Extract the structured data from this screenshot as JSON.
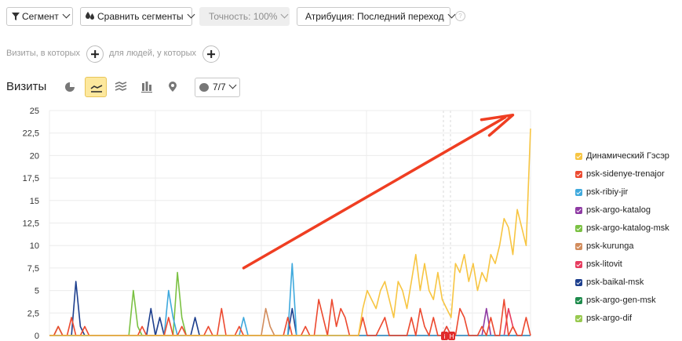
{
  "toolbar": {
    "segment_label": "Сегмент",
    "compare_label": "Сравнить сегменты",
    "accuracy_label": "Точность: 100%",
    "attribution_label": "Атрибуция: Последний переход",
    "help_glyph": "?"
  },
  "filters": {
    "visits_text": "Визиты, в которых",
    "people_text": "для людей, у которых"
  },
  "report": {
    "title": "Визиты",
    "comments_label": "7/7",
    "active_view": "line-chart"
  },
  "colors": {
    "accent": "#fde89d",
    "arrow": "#ef3e22"
  },
  "chart_data": {
    "type": "line",
    "ylim": [
      0,
      25
    ],
    "y_ticks": [
      "0",
      "2,5",
      "5",
      "7,5",
      "10",
      "12,5",
      "15",
      "17,5",
      "20",
      "22,5",
      "25"
    ],
    "x_points": 110,
    "series": [
      {
        "name": "Динамический Гэсэр",
        "color": "#f7c542",
        "values": [
          0,
          0,
          0,
          0,
          0,
          0,
          0,
          0,
          0,
          0,
          0,
          0,
          0,
          0,
          0,
          0,
          0,
          0,
          0,
          0,
          0,
          0,
          0,
          0,
          0,
          0,
          0,
          0,
          0,
          0,
          0,
          0,
          0,
          0,
          0,
          0,
          0,
          0,
          0,
          0,
          0,
          0,
          0,
          0,
          0,
          0,
          0,
          0,
          0,
          0,
          0,
          0,
          0,
          0,
          0,
          0,
          0,
          0,
          0,
          0,
          0,
          0,
          0,
          0,
          0,
          0,
          0,
          0,
          0,
          0,
          0,
          3,
          5,
          4,
          3,
          5,
          6,
          4,
          2,
          6,
          5,
          3,
          6,
          9,
          5,
          8,
          5,
          4,
          7,
          4,
          3,
          2,
          8,
          7,
          9,
          6,
          8,
          5,
          7,
          6,
          9,
          8,
          10,
          13,
          12,
          9,
          14,
          12,
          10,
          23
        ]
      },
      {
        "name": "psk-sidenye-trenajor",
        "color": "#ec4a30",
        "values": [
          0,
          0,
          1,
          0,
          0,
          2,
          0,
          0,
          1,
          0,
          0,
          0,
          0,
          0,
          0,
          0,
          0,
          0,
          0,
          0,
          0,
          1,
          0,
          0,
          0,
          0,
          0,
          2,
          0,
          0,
          1,
          0,
          0,
          0,
          0,
          0,
          1,
          0,
          0,
          3,
          0,
          0,
          0,
          1,
          0,
          0,
          0,
          0,
          0,
          0,
          0,
          0,
          0,
          0,
          2,
          0,
          0,
          0,
          1,
          0,
          0,
          4,
          2,
          0,
          4,
          1,
          3,
          2,
          0,
          0,
          0,
          2,
          0,
          0,
          0,
          1,
          2,
          0,
          0,
          0,
          0,
          0,
          2,
          0,
          3,
          1,
          0,
          2,
          0,
          0,
          1,
          0,
          0,
          3,
          2,
          0,
          0,
          0,
          1,
          0,
          2,
          0,
          0,
          4,
          0,
          1,
          0,
          0,
          2,
          0
        ]
      },
      {
        "name": "psk-ribiy-jir",
        "color": "#3fa9dd",
        "values": [
          0,
          0,
          0,
          0,
          0,
          0,
          0,
          0,
          0,
          0,
          0,
          0,
          0,
          0,
          0,
          0,
          0,
          0,
          0,
          0,
          0,
          0,
          0,
          0,
          0,
          0,
          0,
          5,
          2,
          0,
          0,
          0,
          0,
          0,
          0,
          0,
          0,
          0,
          0,
          0,
          0,
          0,
          0,
          0,
          2,
          0,
          0,
          0,
          0,
          0,
          0,
          0,
          0,
          0,
          0,
          8,
          0,
          0,
          0,
          0,
          0,
          0,
          0,
          0,
          0,
          0,
          0,
          0,
          0,
          0,
          0,
          0,
          0,
          0,
          0,
          0,
          0,
          0,
          0,
          0,
          0,
          0,
          0,
          0,
          0,
          0,
          0,
          0,
          0,
          0,
          0,
          0,
          0,
          0,
          0,
          0,
          0,
          0,
          0,
          0,
          0,
          0,
          0,
          0,
          0,
          0,
          0,
          0,
          0,
          0
        ]
      },
      {
        "name": "psk-argo-katalog",
        "color": "#8e3aa3",
        "values": [
          0,
          0,
          0,
          0,
          0,
          0,
          0,
          0,
          0,
          0,
          0,
          0,
          0,
          0,
          0,
          0,
          0,
          0,
          0,
          0,
          0,
          0,
          0,
          0,
          0,
          0,
          0,
          0,
          0,
          0,
          0,
          0,
          0,
          0,
          0,
          0,
          0,
          0,
          0,
          0,
          0,
          0,
          0,
          0,
          0,
          0,
          0,
          0,
          0,
          0,
          0,
          0,
          0,
          0,
          0,
          0,
          0,
          0,
          0,
          0,
          0,
          0,
          0,
          0,
          0,
          0,
          0,
          0,
          0,
          0,
          0,
          0,
          0,
          0,
          0,
          0,
          0,
          0,
          0,
          0,
          0,
          0,
          0,
          0,
          0,
          0,
          0,
          0,
          0,
          0,
          1,
          0,
          0,
          0,
          0,
          0,
          0,
          0,
          0,
          3,
          0,
          0,
          0,
          0,
          0,
          0,
          0,
          0,
          0,
          0
        ]
      },
      {
        "name": "psk-argo-katalog-msk",
        "color": "#7bc143",
        "values": [
          0,
          0,
          1,
          0,
          0,
          0,
          0,
          0,
          0,
          0,
          0,
          0,
          0,
          0,
          0,
          0,
          0,
          0,
          0,
          5,
          1,
          0,
          0,
          0,
          0,
          0,
          0,
          0,
          0,
          7,
          2,
          0,
          0,
          0,
          0,
          0,
          0,
          0,
          0,
          0,
          0,
          0,
          0,
          0,
          0,
          0,
          0,
          0,
          0,
          0,
          0,
          0,
          0,
          0,
          0,
          0,
          0,
          0,
          0,
          0,
          0,
          0,
          0,
          0,
          0,
          0,
          0,
          0,
          0,
          0,
          0,
          0,
          0,
          0,
          0,
          0,
          0,
          0,
          0,
          0,
          0,
          0,
          0,
          0,
          0,
          0,
          0,
          0,
          0,
          0,
          0,
          0,
          0,
          0,
          0,
          0,
          0,
          0,
          0,
          0,
          0,
          0,
          0,
          0,
          0,
          0,
          0,
          0,
          0,
          0
        ]
      },
      {
        "name": "psk-kurunga",
        "color": "#d28c5c",
        "values": [
          0,
          0,
          0,
          0,
          0,
          0,
          0,
          0,
          0,
          0,
          0,
          0,
          0,
          0,
          0,
          0,
          0,
          0,
          0,
          0,
          0,
          0,
          0,
          0,
          0,
          0,
          0,
          0,
          0,
          0,
          0,
          0,
          0,
          0,
          0,
          0,
          0,
          0,
          0,
          0,
          0,
          0,
          0,
          0,
          0,
          0,
          0,
          0,
          0,
          3,
          1,
          0,
          0,
          0,
          0,
          0,
          0,
          0,
          0,
          0,
          0,
          0,
          0,
          0,
          0,
          0,
          0,
          0,
          0,
          0,
          0,
          0,
          0,
          0,
          0,
          0,
          0,
          0,
          0,
          0,
          0,
          0,
          0,
          0,
          0,
          0,
          0,
          0,
          0,
          0,
          0,
          0,
          0,
          0,
          0,
          0,
          0,
          0,
          0,
          0,
          0,
          0,
          0,
          0,
          0,
          0,
          0,
          0,
          0,
          0
        ]
      },
      {
        "name": "psk-litovit",
        "color": "#e73c5f",
        "values": [
          0,
          0,
          0,
          0,
          0,
          0,
          0,
          0,
          0,
          0,
          0,
          0,
          0,
          0,
          0,
          0,
          0,
          0,
          0,
          0,
          0,
          0,
          0,
          0,
          0,
          0,
          0,
          0,
          0,
          0,
          0,
          0,
          0,
          0,
          0,
          0,
          0,
          0,
          0,
          0,
          0,
          0,
          0,
          0,
          0,
          0,
          0,
          0,
          0,
          0,
          0,
          0,
          0,
          0,
          0,
          0,
          0,
          0,
          0,
          0,
          0,
          0,
          0,
          0,
          0,
          0,
          0,
          0,
          0,
          0,
          0,
          0,
          0,
          0,
          0,
          0,
          0,
          0,
          0,
          0,
          0,
          0,
          0,
          0,
          0,
          0,
          0,
          0,
          0,
          0,
          0,
          0,
          0,
          0,
          0,
          0,
          0,
          0,
          0,
          0,
          0,
          0,
          0,
          0,
          3,
          1,
          0,
          0,
          0,
          0
        ]
      },
      {
        "name": "psk-baikal-msk",
        "color": "#1d3f8e",
        "values": [
          0,
          0,
          0,
          0,
          0,
          0,
          6,
          1,
          0,
          0,
          0,
          0,
          0,
          0,
          0,
          0,
          0,
          0,
          0,
          0,
          0,
          0,
          0,
          3,
          0,
          2,
          0,
          0,
          0,
          0,
          0,
          0,
          0,
          2,
          0,
          0,
          0,
          0,
          0,
          0,
          0,
          0,
          0,
          0,
          0,
          0,
          0,
          0,
          0,
          0,
          0,
          0,
          0,
          0,
          0,
          3,
          0,
          0,
          0,
          0,
          0,
          0,
          0,
          0,
          0,
          0,
          0,
          0,
          0,
          0,
          0,
          0,
          0,
          0,
          0,
          0,
          0,
          0,
          0,
          0,
          0,
          0,
          0,
          0,
          0,
          0,
          0,
          0,
          0,
          0,
          0,
          0,
          0,
          0,
          0,
          0,
          0,
          0,
          0,
          0,
          0,
          0,
          0,
          0,
          0,
          0,
          0,
          0,
          0,
          0
        ]
      },
      {
        "name": "psk-argo-gen-msk",
        "color": "#1e8b4c",
        "values": [
          0,
          0,
          0,
          0,
          0,
          0,
          0,
          0,
          0,
          0,
          0,
          0,
          0,
          0,
          0,
          0,
          0,
          0,
          0,
          0,
          0,
          0,
          0,
          0,
          0,
          0,
          0,
          0,
          0,
          0,
          0,
          0,
          0,
          0,
          0,
          0,
          0,
          0,
          0,
          0,
          0,
          0,
          0,
          0,
          0,
          0,
          0,
          0,
          0,
          0,
          0,
          0,
          0,
          0,
          0,
          0,
          0,
          0,
          0,
          0,
          0,
          0,
          0,
          0,
          0,
          0,
          0,
          0,
          0,
          0,
          0,
          0,
          0,
          0,
          0,
          0,
          0,
          0,
          0,
          0,
          0,
          0,
          0,
          0,
          0,
          0,
          0,
          0,
          0,
          0,
          0,
          0,
          0,
          0,
          0,
          0,
          0,
          0,
          0,
          0,
          0,
          0,
          0,
          0,
          0,
          0,
          0,
          0,
          0,
          0
        ]
      },
      {
        "name": "psk-argo-dif",
        "color": "#98c94f",
        "values": [
          0,
          0,
          0,
          0,
          0,
          0,
          0,
          0,
          0,
          0,
          0,
          0,
          0,
          0,
          0,
          0,
          0,
          0,
          0,
          0,
          0,
          0,
          0,
          0,
          0,
          0,
          0,
          0,
          0,
          0,
          0,
          0,
          0,
          0,
          0,
          0,
          0,
          0,
          0,
          0,
          0,
          0,
          0,
          0,
          0,
          0,
          0,
          0,
          0,
          0,
          0,
          0,
          0,
          0,
          0,
          0,
          0,
          0,
          0,
          0,
          0,
          0,
          0,
          0,
          0,
          0,
          0,
          0,
          0,
          0,
          0,
          0,
          0,
          0,
          0,
          0,
          0,
          0,
          0,
          0,
          0,
          0,
          0,
          0,
          0,
          0,
          0,
          0,
          0,
          0,
          0,
          0,
          0,
          0,
          0,
          0,
          0,
          0,
          0,
          0,
          0,
          0,
          0,
          0,
          0,
          0,
          0,
          0,
          0,
          0
        ]
      }
    ],
    "arrow": {
      "from": [
        44,
        7.5
      ],
      "to": [
        105,
        24.5
      ]
    },
    "marker_labels": [
      "i",
      "H"
    ],
    "grid": true,
    "legend_position": "right"
  }
}
